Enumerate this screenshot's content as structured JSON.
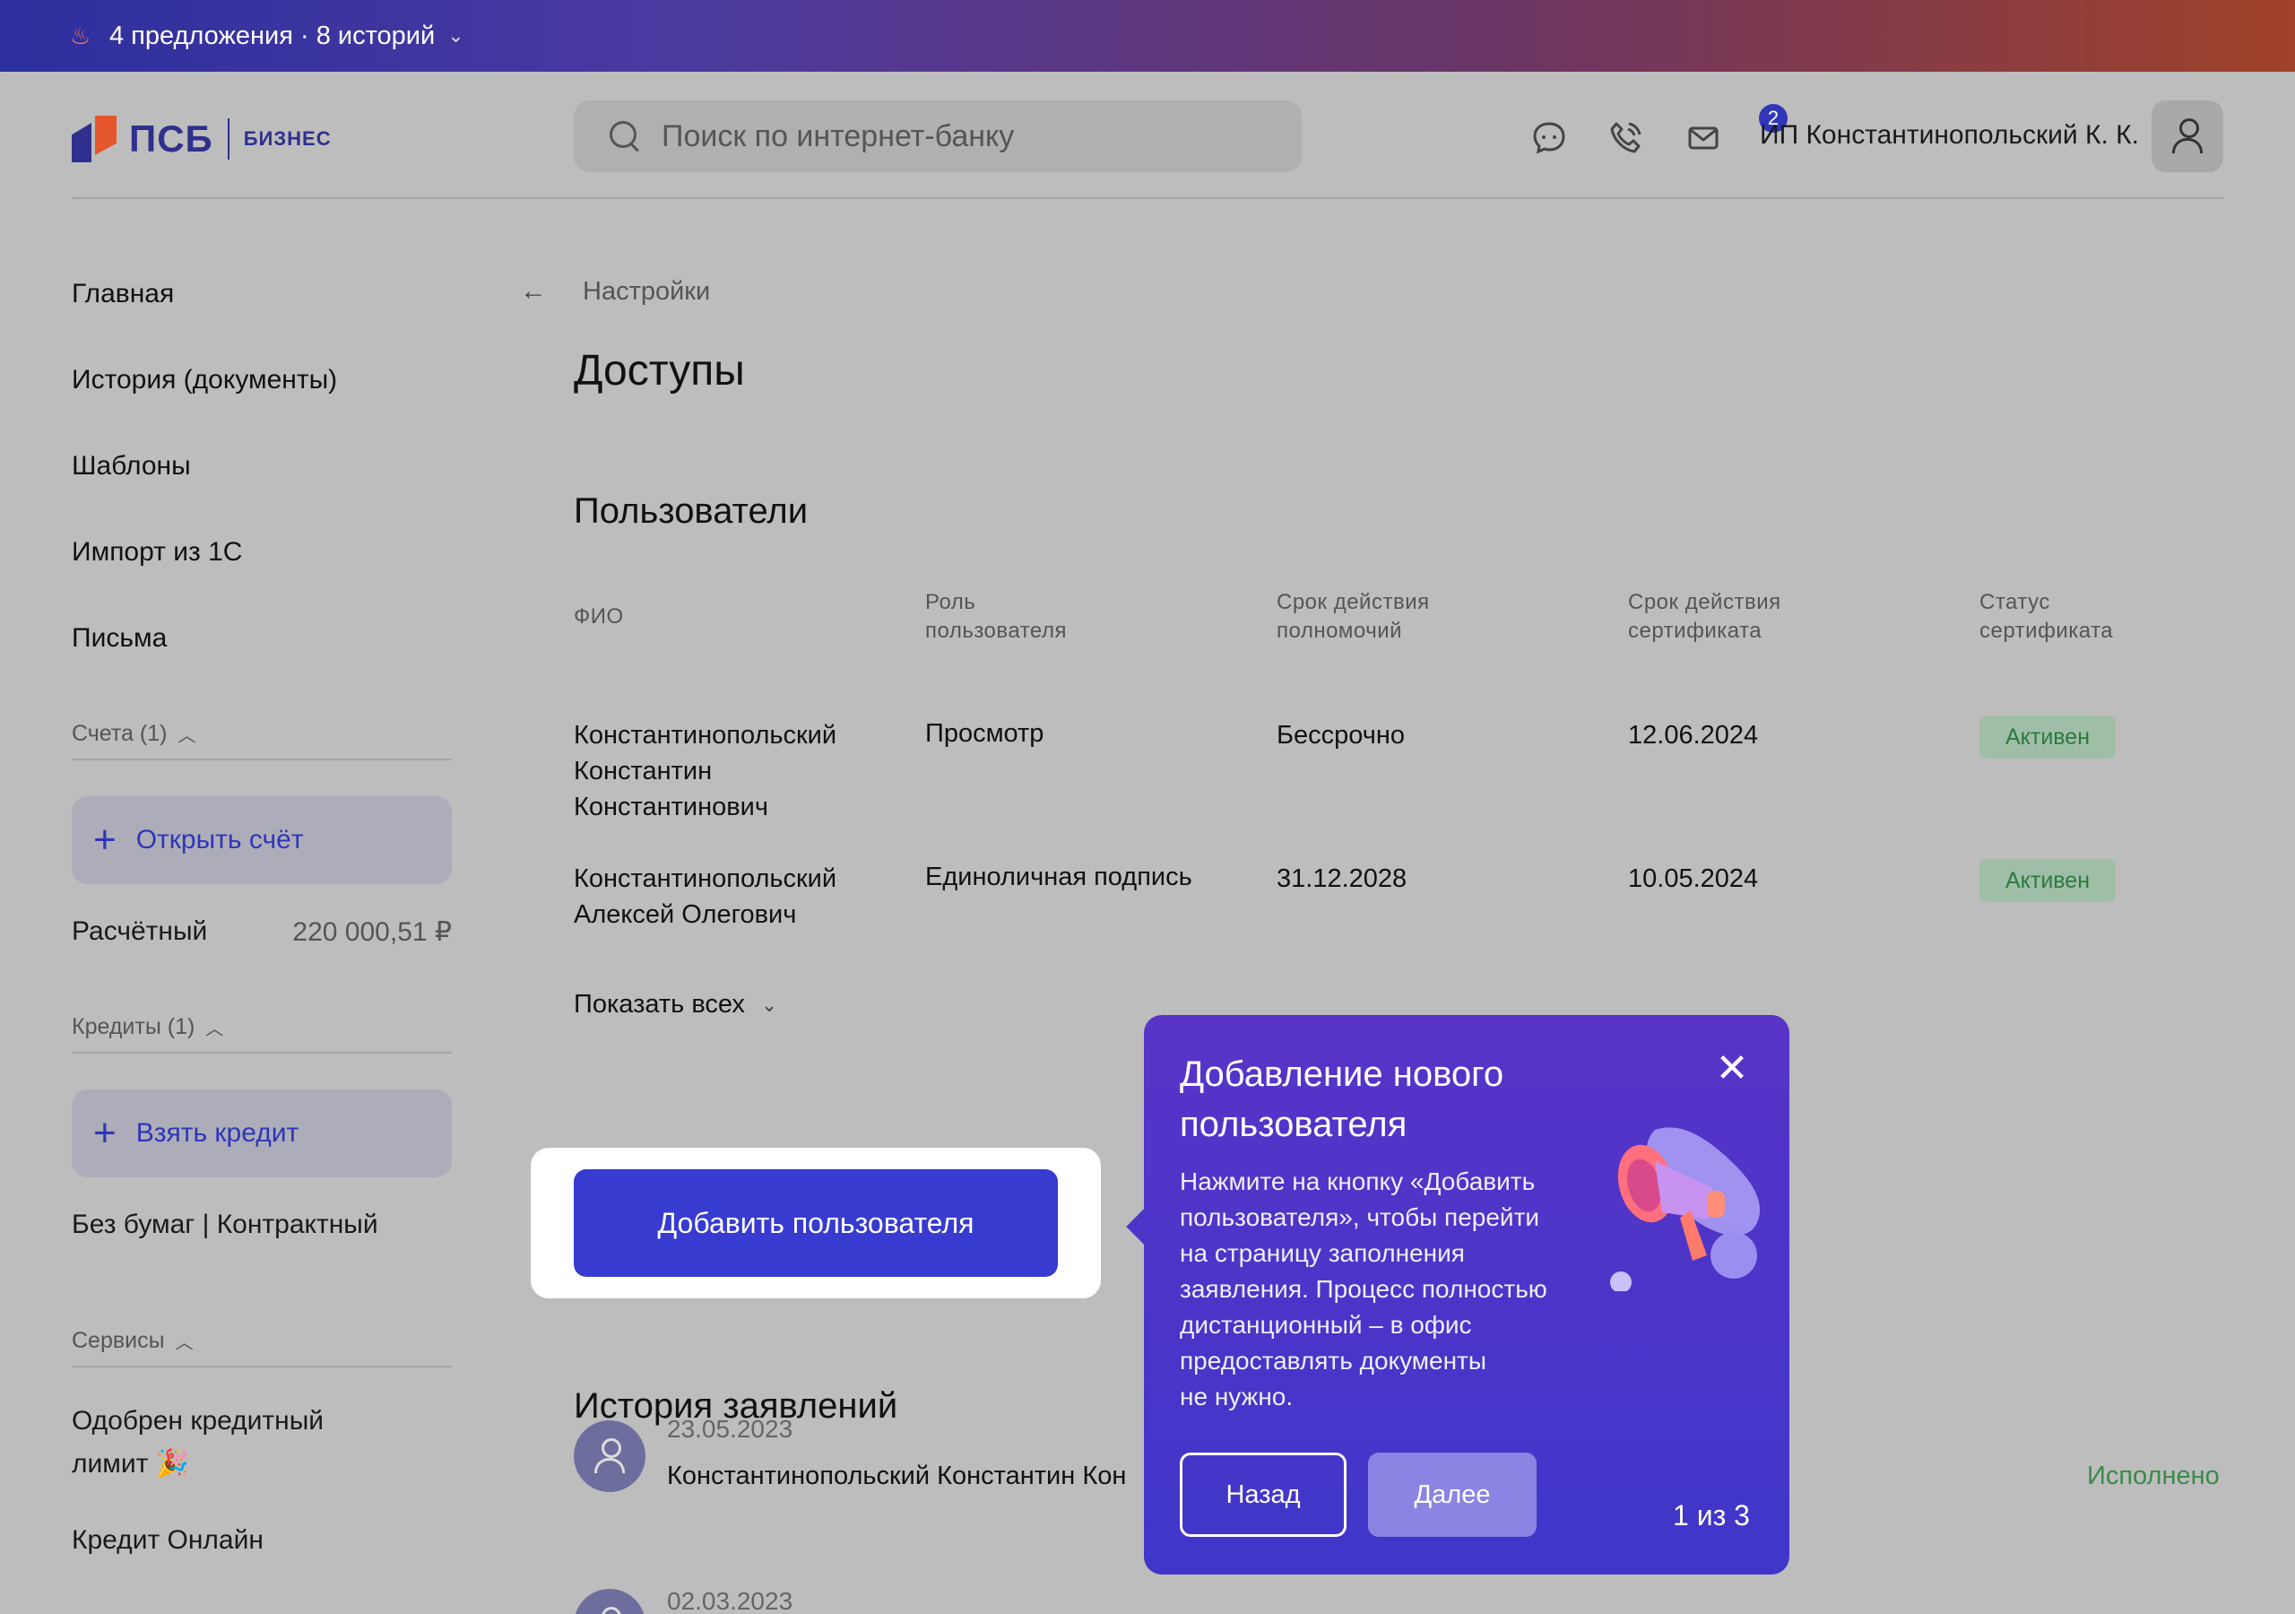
{
  "promo_bar": {
    "text": "4 предложения · 8 историй"
  },
  "header": {
    "logo_main": "ПСБ",
    "logo_sub": "БИЗНЕС",
    "search_placeholder": "Поиск по интернет-банку",
    "messages_badge": "2",
    "company": "ИП Константинопольский К. К."
  },
  "sidebar": {
    "nav": [
      "Главная",
      "История (документы)",
      "Шаблоны",
      "Импорт из 1С",
      "Письма"
    ],
    "accounts": {
      "title": "Счета (1)",
      "cta": "Открыть счёт",
      "account_name": "Расчётный",
      "account_amount": "220 000,51 ₽"
    },
    "credits": {
      "title": "Кредиты (1)",
      "cta": "Взять кредит",
      "product": "Без бумаг | Контрактный"
    },
    "services": {
      "title": "Сервисы",
      "item1_line1": "Одобрен кредитный",
      "item1_line2": "лимит 🎉",
      "item2": "Кредит Онлайн"
    }
  },
  "main": {
    "breadcrumb": "Настройки",
    "title": "Доступы",
    "users_title": "Пользователи",
    "columns": {
      "fio": "ФИО",
      "role_1": "Роль",
      "role_2": "пользователя",
      "term_1": "Срок действия",
      "term_2": "полномочий",
      "cert_1": "Срок действия",
      "cert_2": "сертификата",
      "status_1": "Статус",
      "status_2": "сертификата"
    },
    "users": [
      {
        "name_1": "Константинопольский",
        "name_2": "Константин",
        "name_3": "Константинович",
        "role": "Просмотр",
        "term": "Бессрочно",
        "cert": "12.06.2024",
        "status": "Активен"
      },
      {
        "name_1": "Константинопольский",
        "name_2": "Алексей Олегович",
        "role": "Единоличная подпись",
        "term": "31.12.2028",
        "cert": "10.05.2024",
        "status": "Активен"
      }
    ],
    "show_all": "Показать всех",
    "add_user": "Добавить пользователя",
    "history_title": "История заявлений",
    "history": [
      {
        "date": "23.05.2023",
        "name": "Константинопольский Константин Кон",
        "status": "Исполнено"
      },
      {
        "date": "02.03.2023"
      }
    ]
  },
  "popover": {
    "title": "Добавление нового пользователя",
    "text_lines": [
      "Нажмите на кнопку «Добавить",
      "пользователя», чтобы перейти",
      "на страницу заполнения",
      "заявления. Процесс полностью",
      "дистанционный – в офис",
      "предоставлять документы",
      "не нужно."
    ],
    "back": "Назад",
    "next": "Далее",
    "step": "1 из 3"
  },
  "colors": {
    "accent": "#383bcf",
    "popover": "#4b35c8",
    "status_green": "#2c7a3d",
    "overlay_gray": "#bdbdbd"
  }
}
